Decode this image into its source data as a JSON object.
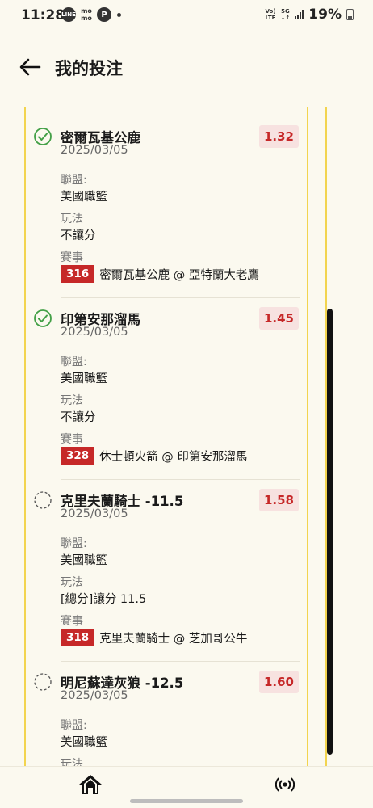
{
  "status_bar": {
    "time": "11:28",
    "app_icons": [
      "LINE",
      "momo",
      "P"
    ],
    "network_volte": "VoLTE",
    "network_5g": "5G",
    "battery": "19%"
  },
  "header": {
    "title": "我的投注",
    "back_icon": "arrow-left-icon"
  },
  "labels": {
    "league": "聯盟:",
    "play": "玩法",
    "event": "賽事"
  },
  "bets": [
    {
      "status": "won",
      "team": "密爾瓦基公鹿",
      "date": "2025/03/05",
      "odds": "1.32",
      "league": "美國職籃",
      "play": "不讓分",
      "event_code": "316",
      "event": "密爾瓦基公鹿 @ 亞特蘭大老鷹"
    },
    {
      "status": "won",
      "team": "印第安那溜馬",
      "date": "2025/03/05",
      "odds": "1.45",
      "league": "美國職籃",
      "play": "不讓分",
      "event_code": "328",
      "event": "休士頓火箭 @ 印第安那溜馬"
    },
    {
      "status": "pending",
      "team": "克里夫蘭騎士 -11.5",
      "date": "2025/03/05",
      "odds": "1.58",
      "league": "美國職籃",
      "play": "[總分]讓分 11.5",
      "event_code": "318",
      "event": "克里夫蘭騎士 @ 芝加哥公牛"
    },
    {
      "status": "pending",
      "team": "明尼蘇達灰狼 -12.5",
      "date": "2025/03/05",
      "odds": "1.60",
      "league": "美國職籃",
      "play_label_partial": "玩法"
    }
  ],
  "bottom_nav": {
    "home_icon": "home-icon",
    "live_icon": "broadcast-icon"
  },
  "colors": {
    "background": "#fbf9ef",
    "accent_yellow": "#f2d44f",
    "odds_red": "#c62828",
    "won_green": "#43a047"
  }
}
